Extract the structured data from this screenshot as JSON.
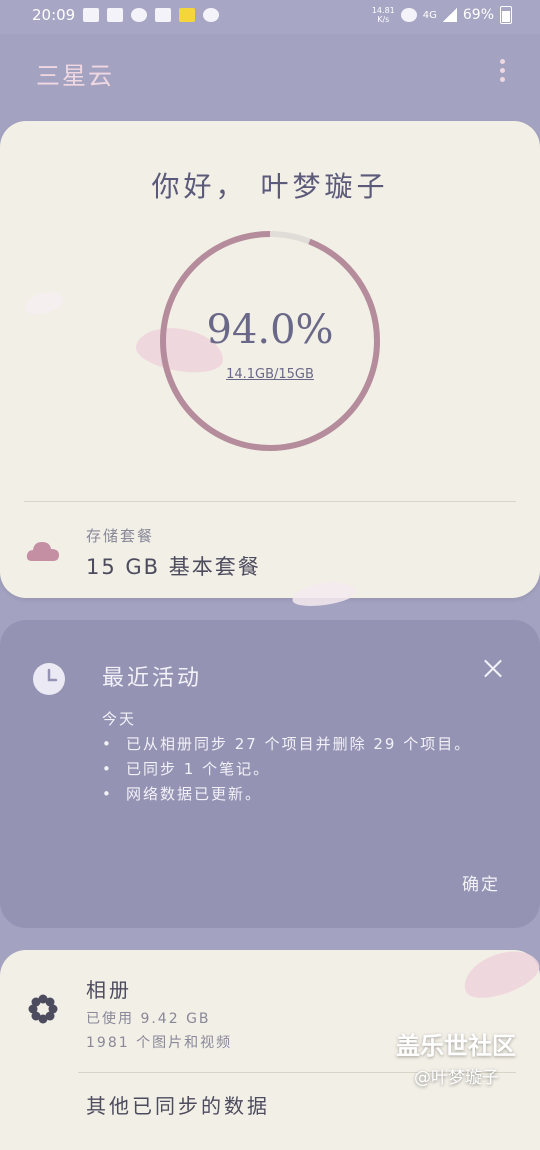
{
  "status_bar": {
    "time": "20:09",
    "net_speed": "14.81\nK/s",
    "network": "4G",
    "battery": "69%"
  },
  "app": {
    "title": "三星云"
  },
  "storage": {
    "greeting": "你好，  叶梦璇子",
    "percent": "94.0%",
    "used_fraction": 0.94,
    "used_text": "14.1GB/15GB",
    "plan_label": "存储套餐",
    "plan_value": "15 GB 基本套餐"
  },
  "activity": {
    "title": "最近活动",
    "day": "今天",
    "items": [
      "已从相册同步 27 个项目并删除 29 个项目。",
      "已同步 1 个笔记。",
      "网络数据已更新。"
    ],
    "confirm_label": "确定"
  },
  "album": {
    "title": "相册",
    "used": "已使用 9.42 GB",
    "count": "1981 个图片和视频",
    "other_title": "其他已同步的数据"
  },
  "watermark": {
    "main": "盖乐世社区",
    "sub": "@叶梦璇子"
  },
  "colors": {
    "background": "#a3a2c0",
    "card": "#f2efe6",
    "gauge_ring": "#b58c9b",
    "gauge_remaining": "#e0ddd8",
    "activity_card": "#9493b3",
    "accent_icon": "#c48ea3"
  }
}
